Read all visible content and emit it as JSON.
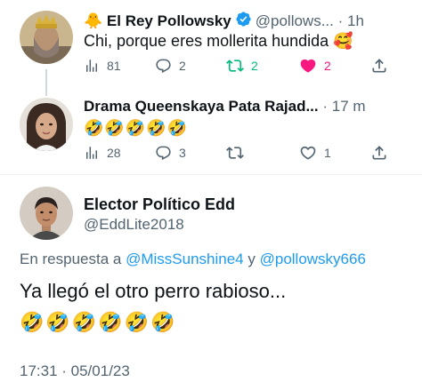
{
  "tweets": [
    {
      "name": "El Rey Pollowsky",
      "name_emoji": "🐥",
      "handle": "@pollows...",
      "time": "1h",
      "text": "Chi, porque eres mollerita hundida 🥰",
      "views": "81",
      "replies": "2",
      "retweets": "2",
      "likes": "2",
      "verified": true
    },
    {
      "name": "Drama Queenskaya Pata Rajad...",
      "time": "17 m",
      "emoji": "🤣🤣🤣🤣🤣",
      "views": "28",
      "replies": "3",
      "likes": "1"
    }
  ],
  "main": {
    "name": "Elector Político Edd",
    "handle": "@EddLite2018",
    "reply_prefix": "En respuesta a",
    "mention1": "@MissSunshine4",
    "reply_join": "y",
    "mention2": "@pollowsky666",
    "text": "Ya llegó el otro perro rabioso...",
    "emoji": "🤣🤣🤣🤣🤣🤣",
    "timestamp": "17:31 · 05/01/23"
  },
  "sep": "·",
  "colors": {
    "text": "#0f1419",
    "muted": "#536471",
    "link": "#1d9bf0",
    "retweet_active": "#00ba7c",
    "like_active": "#f91880"
  },
  "icons": [
    "views-icon",
    "reply-icon",
    "retweet-icon",
    "heart-icon",
    "share-icon",
    "verified-icon"
  ]
}
